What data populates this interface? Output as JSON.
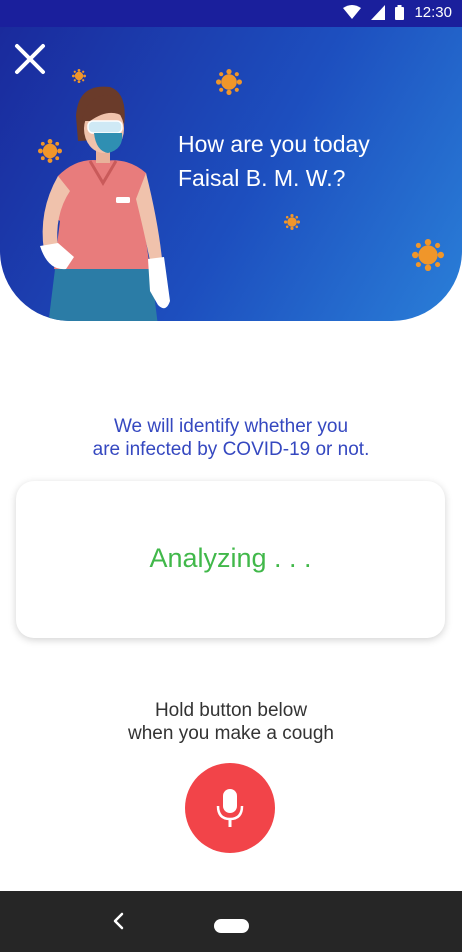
{
  "status_bar": {
    "time": "12:30"
  },
  "header": {
    "greeting_line1": "How are you today",
    "greeting_line2": "Faisal B. M. W.?"
  },
  "intro": {
    "line1": "We will identify whether you",
    "line2": "are infected by COVID-19 or not."
  },
  "card": {
    "status": "Analyzing . . ."
  },
  "hint": {
    "line1": "Hold button below",
    "line2": "when you make a cough"
  },
  "colors": {
    "header_gradient_start": "#1a2a9c",
    "header_gradient_end": "#2a7fd8",
    "analyzing_text": "#41b84a",
    "mic_button": "#f24449",
    "intro_text": "#3548c0"
  },
  "icons": {
    "close": "close-icon",
    "mic": "microphone-icon",
    "back": "back-icon",
    "home": "home-pill"
  }
}
